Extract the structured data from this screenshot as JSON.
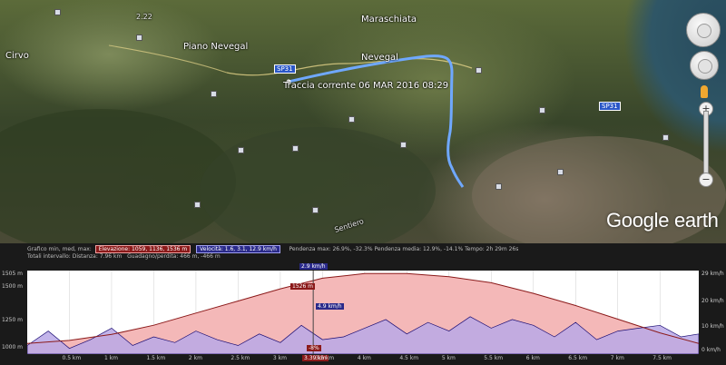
{
  "map": {
    "places": {
      "maraschiata": "Maraschiata",
      "piano_nevegal": "Piano Nevegal",
      "nevegal": "Nevegal",
      "cirvo": "Cirvo"
    },
    "track_label": "Traccia corrente  06 MAR 2016 08:29",
    "road_label": "SP31",
    "trail_label": "Sentiero",
    "elev_label": "2.22",
    "logo": "Google earth",
    "colors": {
      "track": "#6fa8ff",
      "lake": "#2f5666"
    }
  },
  "controls": {
    "look_icon": "look-joystick-icon",
    "move_icon": "move-joystick-icon",
    "streetview_icon": "pegman-icon",
    "zoom_in": "+",
    "zoom_out": "−"
  },
  "profile": {
    "stats": {
      "graph_label": "Grafico min, med, max:",
      "elevation_tag": "Elevazione: 1059, 1136, 1536 m",
      "speed_tag": "Velocità: 1.6, 3.1, 12.9 km/h",
      "total_label": "Totali intervallo:",
      "distance": "Distanza: 7.96 km",
      "gain": "Guadagno/perdita: 466 m, -466 m",
      "slope_max": "Pendenza max: 26.9%, -32.3%",
      "slope_avg": "Pendenza media: 12.9%, -14.1%",
      "time": "Tempo: 2h 29m 26s"
    },
    "y_left": [
      "1505 m",
      "1500 m",
      "1250 m",
      "1000 m"
    ],
    "y_right": [
      "29 km/h",
      "20 km/h",
      "10 km/h",
      "0 km/h"
    ],
    "x_ticks": [
      "0.5 km",
      "1 km",
      "1.5 km",
      "2 km",
      "2.5 km",
      "3 km",
      "3.5 km",
      "4 km",
      "4.5 km",
      "5 km",
      "5.5 km",
      "6 km",
      "6.5 km",
      "7 km",
      "7.5 km"
    ],
    "cursor": {
      "top": "2.9 km/h",
      "elev": "1526 m",
      "speed": "4.9 km/h",
      "slope": "-8%",
      "dist": "3.39 km"
    },
    "colors": {
      "elevation_fill": "#f4b8b8",
      "elevation_line": "#8b1a1a",
      "speed_fill": "#b9a8e6",
      "speed_line": "#1b0d73"
    }
  },
  "chart_data": {
    "type": "area",
    "xlabel": "",
    "ylabel": "",
    "x_unit": "km",
    "xlim": [
      0,
      7.96
    ],
    "series": [
      {
        "name": "Elevazione",
        "unit": "m",
        "x": [
          0,
          0.5,
          1,
          1.5,
          2,
          2.5,
          3,
          3.5,
          4,
          4.5,
          5,
          5.5,
          6,
          6.5,
          7,
          7.5,
          7.96
        ],
        "values": [
          1070,
          1090,
          1130,
          1190,
          1270,
          1350,
          1430,
          1500,
          1530,
          1530,
          1510,
          1470,
          1400,
          1320,
          1230,
          1140,
          1070
        ]
      },
      {
        "name": "Velocità",
        "unit": "km/h",
        "x": [
          0,
          0.25,
          0.5,
          0.75,
          1,
          1.25,
          1.5,
          1.75,
          2,
          2.25,
          2.5,
          2.75,
          3,
          3.25,
          3.5,
          3.75,
          4,
          4.25,
          4.5,
          4.75,
          5,
          5.25,
          5.5,
          5.75,
          6,
          6.25,
          6.5,
          6.75,
          7,
          7.25,
          7.5,
          7.75,
          7.96
        ],
        "values": [
          3,
          8,
          2,
          5,
          9,
          3,
          6,
          4,
          8,
          5,
          3,
          7,
          4,
          10,
          5,
          6,
          9,
          12,
          7,
          11,
          8,
          13,
          9,
          12,
          10,
          6,
          11,
          5,
          8,
          9,
          10,
          6,
          7
        ]
      }
    ]
  }
}
